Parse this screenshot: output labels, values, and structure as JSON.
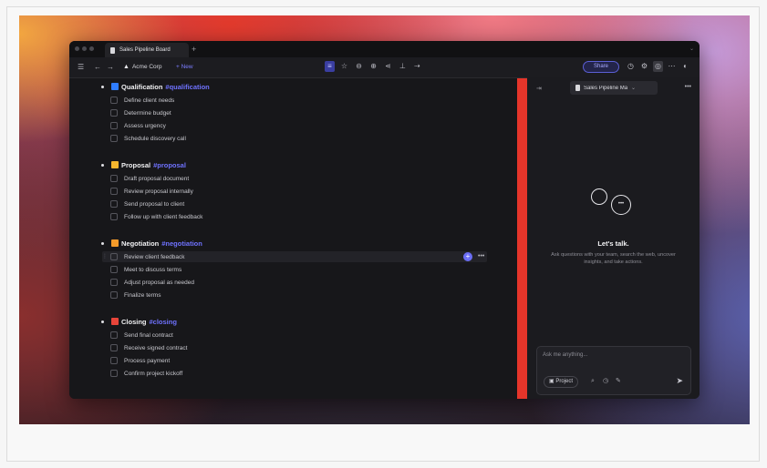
{
  "tab": {
    "title": "Sales Pipeline Board",
    "new_tab": "+"
  },
  "toolbar": {
    "workspace": "Acme Corp",
    "new_label": "+ New",
    "share_label": "Share"
  },
  "sections": [
    {
      "title": "Qualification",
      "tag": "#qualification",
      "color": "#2f7dff",
      "tasks": [
        "Define client needs",
        "Determine budget",
        "Assess urgency",
        "Schedule discovery call"
      ]
    },
    {
      "title": "Proposal",
      "tag": "#proposal",
      "color": "#f5b62e",
      "tasks": [
        "Draft proposal document",
        "Review proposal internally",
        "Send proposal to client",
        "Follow up with client feedback"
      ]
    },
    {
      "title": "Negotiation",
      "tag": "#negotiation",
      "color": "#f39a2a",
      "tasks": [
        "Review client feedback",
        "Meet to discuss terms",
        "Adjust proposal as needed",
        "Finalize terms"
      ]
    },
    {
      "title": "Closing",
      "tag": "#closing",
      "color": "#e8453a",
      "tasks": [
        "Send final contract",
        "Receive signed contract",
        "Process payment",
        "Confirm project kickoff"
      ]
    }
  ],
  "chat": {
    "doc_selector": "Sales Pipeline Ma",
    "title": "Let's talk.",
    "subtitle": "Ask questions with your team, search the web, uncover insights, and take actions.",
    "input_placeholder": "Ask me anything...",
    "project_label": "Project"
  }
}
